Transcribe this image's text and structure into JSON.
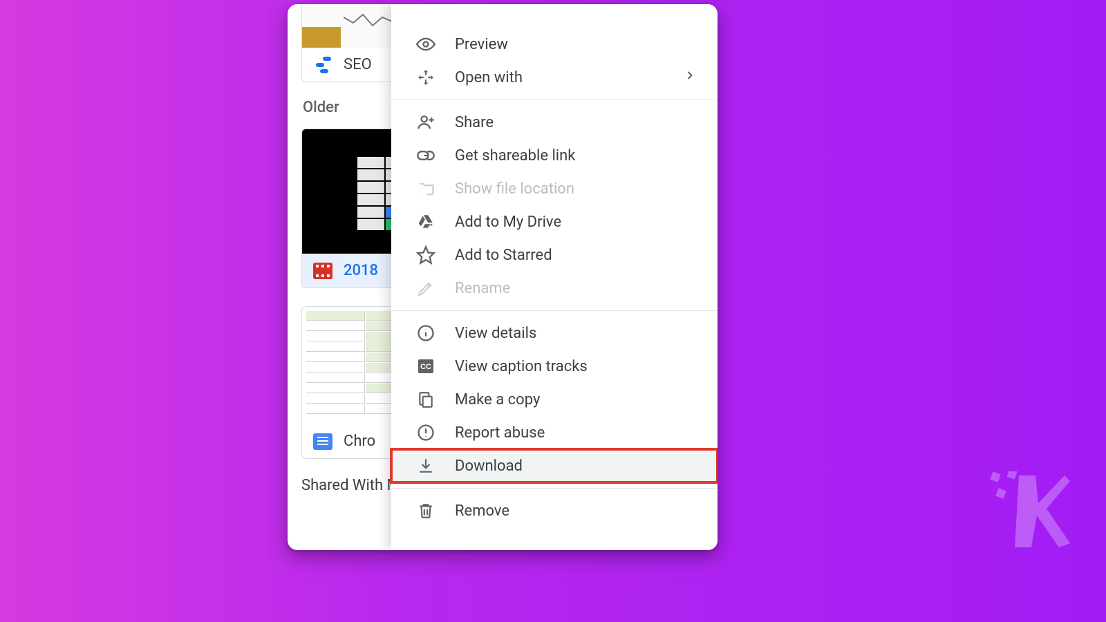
{
  "files": {
    "card1_label": "SEO",
    "card2_label": "2018",
    "card3_label": "Chro"
  },
  "sections": {
    "older": "Older",
    "shared": "Shared With M"
  },
  "menu": {
    "preview": "Preview",
    "open_with": "Open with",
    "share": "Share",
    "get_link": "Get shareable link",
    "show_location": "Show file location",
    "add_drive": "Add to My Drive",
    "add_starred": "Add to Starred",
    "rename": "Rename",
    "view_details": "View details",
    "view_captions": "View caption tracks",
    "make_copy": "Make a copy",
    "report_abuse": "Report abuse",
    "download": "Download",
    "remove": "Remove"
  }
}
